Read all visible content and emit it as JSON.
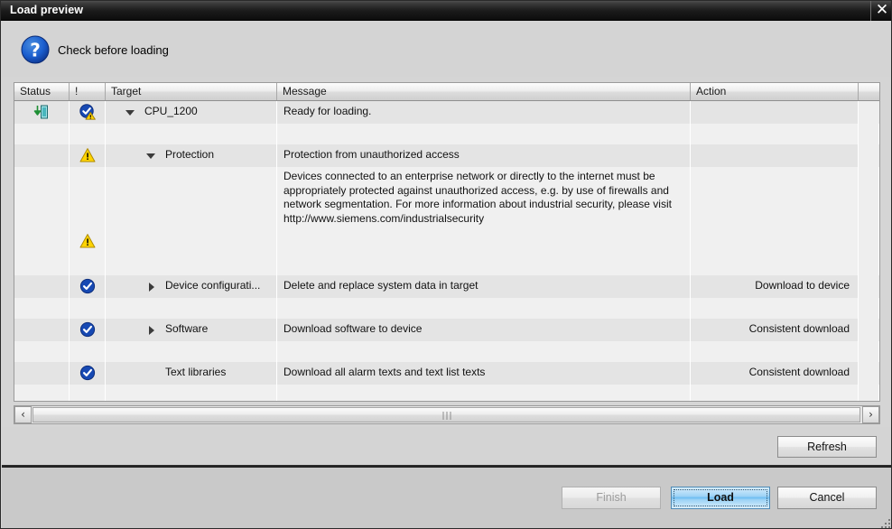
{
  "window": {
    "title": "Load preview",
    "close_label": "✕"
  },
  "header": {
    "help_icon": "question-circle-icon",
    "title": "Check before loading"
  },
  "table": {
    "columns": [
      {
        "key": "status",
        "label": "Status"
      },
      {
        "key": "excl",
        "label": "!"
      },
      {
        "key": "target",
        "label": "Target"
      },
      {
        "key": "message",
        "label": "Message"
      },
      {
        "key": "action",
        "label": "Action"
      }
    ],
    "rows": [
      {
        "status_icon": "download-to-device-icon",
        "flag_icon": "check-circle-warning-icon",
        "twisty": "expanded",
        "target": "CPU_1200",
        "message": "Ready for loading.",
        "action": ""
      },
      {
        "status_icon": "",
        "flag_icon": "warning-triangle-icon",
        "twisty": "expanded",
        "target": "Protection",
        "message": "Protection from unauthorized access",
        "action": ""
      },
      {
        "status_icon": "",
        "flag_icon": "warning-triangle-icon",
        "twisty": "none",
        "target": "",
        "message": "Devices connected to an enterprise network or directly to the internet must be appropriately protected against unauthorized access, e.g. by use of firewalls and network segmentation. For more information about industrial security, please visit http://www.siemens.com/industrialsecurity",
        "action": ""
      },
      {
        "status_icon": "",
        "flag_icon": "check-circle-icon",
        "twisty": "collapsed",
        "target": "Device configurati...",
        "message": "Delete and replace system data in target",
        "action": "Download to device"
      },
      {
        "status_icon": "",
        "flag_icon": "check-circle-icon",
        "twisty": "collapsed",
        "target": "Software",
        "message": "Download software to device",
        "action": "Consistent download"
      },
      {
        "status_icon": "",
        "flag_icon": "check-circle-icon",
        "twisty": "none",
        "target": "Text libraries",
        "message": "Download all alarm texts and text list texts",
        "action": "Consistent download"
      }
    ]
  },
  "scrollbar": {
    "left_arrow": "‹",
    "right_arrow": "›",
    "name": "horizontal-scrollbar"
  },
  "buttons": {
    "refresh": "Refresh",
    "finish": "Finish",
    "load": "Load",
    "cancel": "Cancel"
  },
  "colors": {
    "accent": "#1b5fa8",
    "warning": "#ffd400",
    "ok": "#1749b3",
    "titlebar": "#1b1b1b"
  }
}
